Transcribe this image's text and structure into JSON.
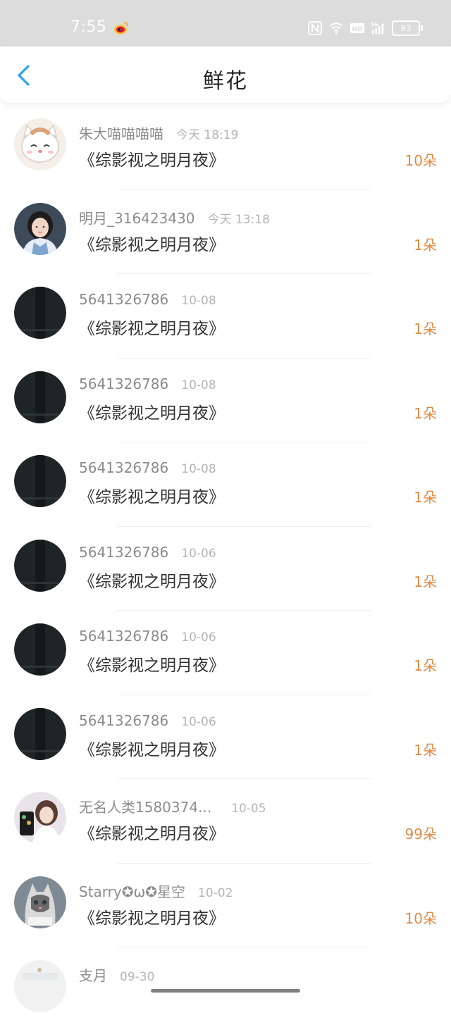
{
  "status_bar": {
    "time": "7:55",
    "battery": "93",
    "icons": [
      "weibo-icon",
      "nfc-icon",
      "wifi-icon",
      "hd-icon",
      "5g-signal-icon",
      "battery-icon"
    ]
  },
  "header": {
    "title": "鲜花",
    "back_icon": "chevron-left-icon",
    "accent": "#2aa3ef"
  },
  "colors": {
    "count": "#e08a45",
    "name": "#8c8c8c",
    "time": "#b5b5b5"
  },
  "rows": [
    {
      "name": "朱大喵喵喵喵",
      "time": "今天 18:19",
      "book": "《综影视之明月夜》",
      "count": "10朵",
      "avatar": "cat-cartoon-avatar"
    },
    {
      "name": "明月_316423430",
      "time": "今天 13:18",
      "book": "《综影视之明月夜》",
      "count": "1朵",
      "avatar": "girl-photo-avatar"
    },
    {
      "name": "5641326786",
      "time": "10-08",
      "book": "《综影视之明月夜》",
      "count": "1朵",
      "avatar": "dark-avatar"
    },
    {
      "name": "5641326786",
      "time": "10-08",
      "book": "《综影视之明月夜》",
      "count": "1朵",
      "avatar": "dark-avatar"
    },
    {
      "name": "5641326786",
      "time": "10-08",
      "book": "《综影视之明月夜》",
      "count": "1朵",
      "avatar": "dark-avatar"
    },
    {
      "name": "5641326786",
      "time": "10-06",
      "book": "《综影视之明月夜》",
      "count": "1朵",
      "avatar": "dark-avatar"
    },
    {
      "name": "5641326786",
      "time": "10-06",
      "book": "《综影视之明月夜》",
      "count": "1朵",
      "avatar": "dark-avatar"
    },
    {
      "name": "5641326786",
      "time": "10-06",
      "book": "《综影视之明月夜》",
      "count": "1朵",
      "avatar": "dark-avatar"
    },
    {
      "name": "无名人类1580374...",
      "time": "10-05",
      "book": "《综影视之明月夜》",
      "count": "99朵",
      "avatar": "girl-phone-avatar"
    },
    {
      "name": "Starry✪ω✪星空",
      "time": "10-02",
      "book": "《综影视之明月夜》",
      "count": "10朵",
      "avatar": "kitten-avatar"
    },
    {
      "name": "支月",
      "time": "09-30",
      "book": "",
      "count": "",
      "avatar": "light-avatar"
    }
  ]
}
